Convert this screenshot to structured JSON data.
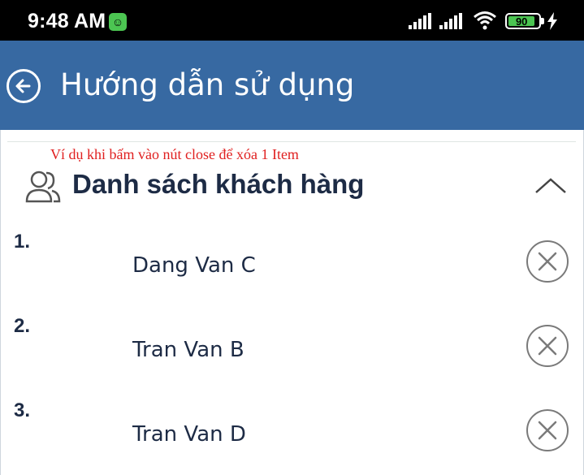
{
  "status_bar": {
    "time": "9:48 AM",
    "app_icon": "android-notification-icon",
    "battery_level": "90",
    "battery_percent": 90,
    "icons": [
      "signal-icon",
      "signal-icon",
      "wifi-icon",
      "battery-icon",
      "charging-icon"
    ]
  },
  "app_bar": {
    "back_icon": "back-arrow-circle-icon",
    "title": "Hướng dẫn sử dụng",
    "background": "#3769a2"
  },
  "note": "Ví dụ khi bấm vào nút close để xóa 1 Item",
  "section": {
    "icon": "users-icon",
    "title": "Danh sách khách hàng",
    "collapse_icon": "chevron-up-icon"
  },
  "customers": [
    {
      "number": "1.",
      "name": "Dang Van C"
    },
    {
      "number": "2.",
      "name": "Tran Van B"
    },
    {
      "number": "3.",
      "name": "Tran Van D"
    }
  ],
  "colors": {
    "primary": "#3769a2",
    "note_text": "#e02020",
    "text_dark": "#1d2b45",
    "close_icon": "#7a7a7a"
  }
}
